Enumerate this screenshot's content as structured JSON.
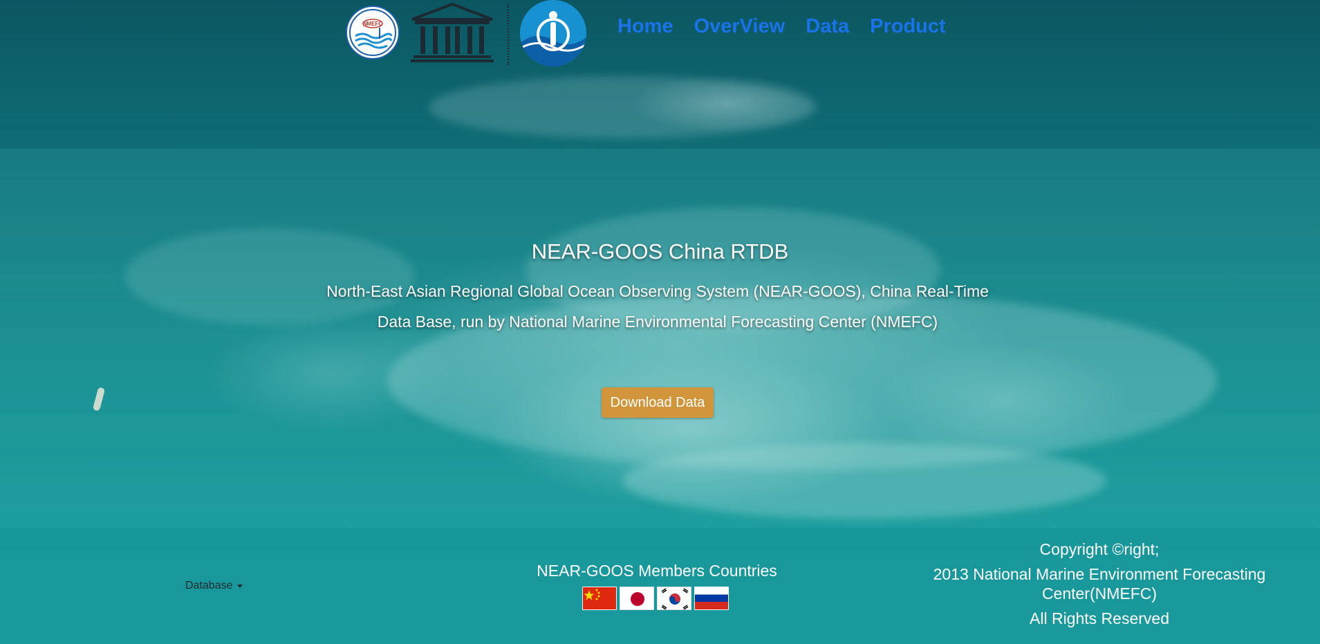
{
  "header": {
    "nav": [
      {
        "label": "Home"
      },
      {
        "label": "OverView"
      },
      {
        "label": "Data"
      },
      {
        "label": "Product"
      }
    ],
    "logos": {
      "nmefc": "NMEFC",
      "unesco": "unesco-temple-icon",
      "ioc": "ioc-wave-icon"
    },
    "nav_color": "#1a73e8"
  },
  "hero": {
    "title": "NEAR-GOOS China RTDB",
    "description": "North-East Asian Regional Global Ocean Observing System (NEAR-GOOS), China Real-Time Data Base, run by National Marine Environmental Forecasting Center (NMEFC)",
    "download_label": "Download Data",
    "button_color": "#d1963c"
  },
  "footer": {
    "database_label": "Database",
    "members_title": "NEAR-GOOS Members Countries",
    "flags": [
      "China",
      "Japan",
      "Korea",
      "Russia"
    ],
    "copyright_line1": "Copyright ©right;",
    "copyright_line2": "2013 National Marine Environment Forecasting Center(NMEFC)",
    "copyright_line3": "All Rights Reserved"
  }
}
